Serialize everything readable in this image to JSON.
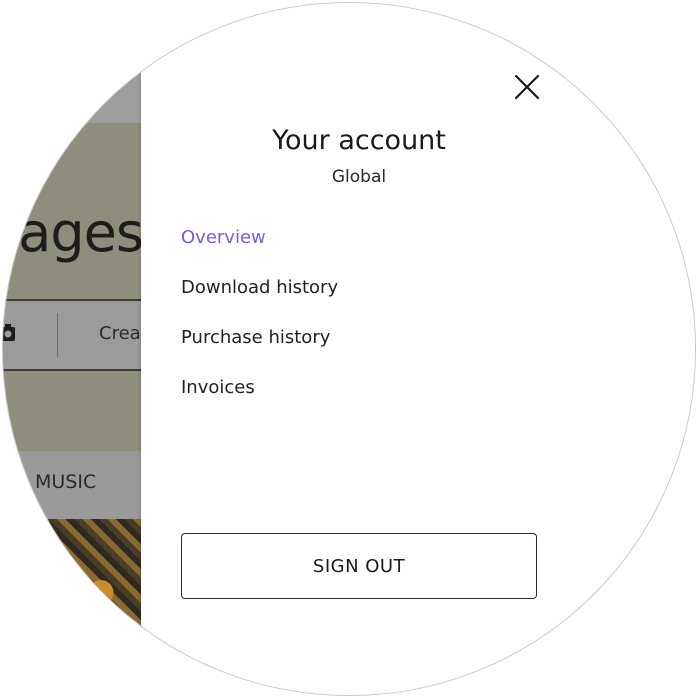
{
  "background_page": {
    "heading_fragment": "ages",
    "search_create_fragment": "Crea",
    "tab_music": "MUSIC"
  },
  "account_panel": {
    "title": "Your account",
    "region": "Global",
    "menu": [
      {
        "label": "Overview",
        "active": true
      },
      {
        "label": "Download history",
        "active": false
      },
      {
        "label": "Purchase history",
        "active": false
      },
      {
        "label": "Invoices",
        "active": false
      }
    ],
    "sign_out_label": "SIGN OUT",
    "close_icon": "close-icon"
  },
  "colors": {
    "accent": "#7b5ce0",
    "text": "#1a1a1a",
    "overlay": "#9a9a9a"
  }
}
